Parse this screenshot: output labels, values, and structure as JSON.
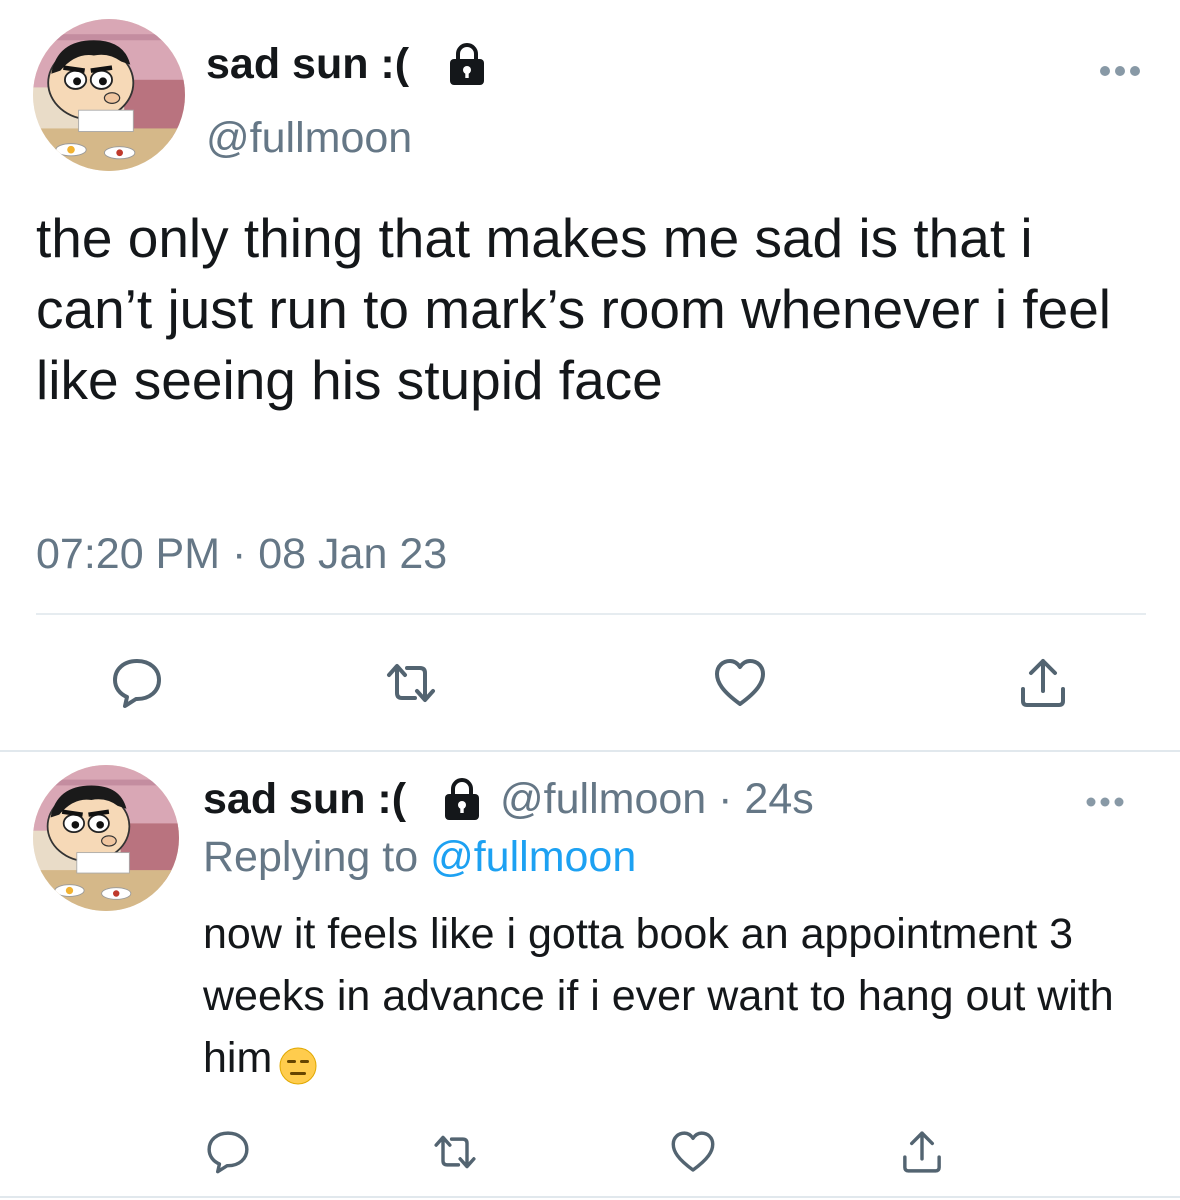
{
  "main_tweet": {
    "display_name": "sad sun :(",
    "handle": "@fullmoon",
    "text": "the only thing that makes me sad is that i can’t just run to mark’s room whenever i feel like seeing his stupid face",
    "timestamp": "07:20 PM · 08 Jan 23",
    "icons": {
      "lock": "lock-icon",
      "more": "more-icon",
      "reply": "reply-icon",
      "retweet": "retweet-icon",
      "like": "heart-icon",
      "share": "share-icon"
    }
  },
  "reply_tweet": {
    "display_name": "sad sun :(",
    "handle": "@fullmoon",
    "separator": " · ",
    "age": "24s",
    "replying_prefix": "Replying to ",
    "replying_mention": "@fullmoon",
    "text": "now it feels like i gotta book an appointment 3 weeks in advance if i ever want to hang out with him",
    "emoji": "expressionless-face-emoji"
  },
  "colors": {
    "text_primary": "#14171a",
    "text_secondary": "#657786",
    "link": "#1da1f2",
    "icon": "#536471",
    "divider": "#e1e8ed"
  }
}
